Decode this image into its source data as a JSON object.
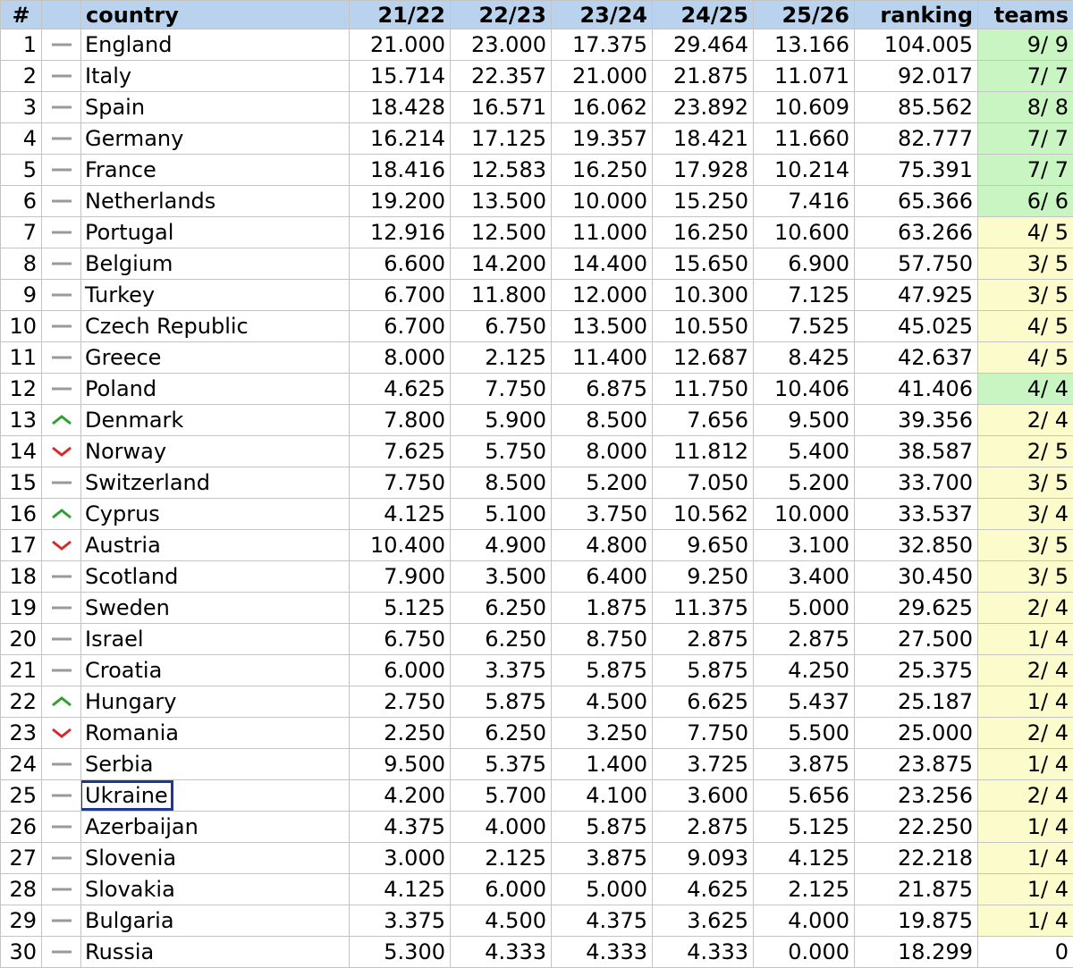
{
  "headers": {
    "rank": "#",
    "trend": "",
    "country": "country",
    "s1": "21/22",
    "s2": "22/23",
    "s3": "23/24",
    "s4": "24/25",
    "s5": "25/26",
    "ranking": "ranking",
    "teams": "teams"
  },
  "colors": {
    "header_bg": "#b9d3ee",
    "teams_complete": "#c8f5c1",
    "teams_partial": "#fbfbcb",
    "trend_up": "#2ea02e",
    "trend_down": "#d52b2b",
    "trend_same": "#9a9a9a",
    "selection_border": "#1d3a8f"
  },
  "selected_country": "Ukraine",
  "rows": [
    {
      "rank": "1",
      "trend": "same",
      "country": "England",
      "s1": "21.000",
      "s2": "23.000",
      "s3": "17.375",
      "s4": "29.464",
      "s5": "13.166",
      "ranking": "104.005",
      "teams": "9/ 9",
      "teams_status": "complete"
    },
    {
      "rank": "2",
      "trend": "same",
      "country": "Italy",
      "s1": "15.714",
      "s2": "22.357",
      "s3": "21.000",
      "s4": "21.875",
      "s5": "11.071",
      "ranking": "92.017",
      "teams": "7/ 7",
      "teams_status": "complete"
    },
    {
      "rank": "3",
      "trend": "same",
      "country": "Spain",
      "s1": "18.428",
      "s2": "16.571",
      "s3": "16.062",
      "s4": "23.892",
      "s5": "10.609",
      "ranking": "85.562",
      "teams": "8/ 8",
      "teams_status": "complete"
    },
    {
      "rank": "4",
      "trend": "same",
      "country": "Germany",
      "s1": "16.214",
      "s2": "17.125",
      "s3": "19.357",
      "s4": "18.421",
      "s5": "11.660",
      "ranking": "82.777",
      "teams": "7/ 7",
      "teams_status": "complete"
    },
    {
      "rank": "5",
      "trend": "same",
      "country": "France",
      "s1": "18.416",
      "s2": "12.583",
      "s3": "16.250",
      "s4": "17.928",
      "s5": "10.214",
      "ranking": "75.391",
      "teams": "7/ 7",
      "teams_status": "complete"
    },
    {
      "rank": "6",
      "trend": "same",
      "country": "Netherlands",
      "s1": "19.200",
      "s2": "13.500",
      "s3": "10.000",
      "s4": "15.250",
      "s5": "7.416",
      "ranking": "65.366",
      "teams": "6/ 6",
      "teams_status": "complete"
    },
    {
      "rank": "7",
      "trend": "same",
      "country": "Portugal",
      "s1": "12.916",
      "s2": "12.500",
      "s3": "11.000",
      "s4": "16.250",
      "s5": "10.600",
      "ranking": "63.266",
      "teams": "4/ 5",
      "teams_status": "partial"
    },
    {
      "rank": "8",
      "trend": "same",
      "country": "Belgium",
      "s1": "6.600",
      "s2": "14.200",
      "s3": "14.400",
      "s4": "15.650",
      "s5": "6.900",
      "ranking": "57.750",
      "teams": "3/ 5",
      "teams_status": "partial"
    },
    {
      "rank": "9",
      "trend": "same",
      "country": "Turkey",
      "s1": "6.700",
      "s2": "11.800",
      "s3": "12.000",
      "s4": "10.300",
      "s5": "7.125",
      "ranking": "47.925",
      "teams": "3/ 5",
      "teams_status": "partial"
    },
    {
      "rank": "10",
      "trend": "same",
      "country": "Czech Republic",
      "s1": "6.700",
      "s2": "6.750",
      "s3": "13.500",
      "s4": "10.550",
      "s5": "7.525",
      "ranking": "45.025",
      "teams": "4/ 5",
      "teams_status": "partial"
    },
    {
      "rank": "11",
      "trend": "same",
      "country": "Greece",
      "s1": "8.000",
      "s2": "2.125",
      "s3": "11.400",
      "s4": "12.687",
      "s5": "8.425",
      "ranking": "42.637",
      "teams": "4/ 5",
      "teams_status": "partial"
    },
    {
      "rank": "12",
      "trend": "same",
      "country": "Poland",
      "s1": "4.625",
      "s2": "7.750",
      "s3": "6.875",
      "s4": "11.750",
      "s5": "10.406",
      "ranking": "41.406",
      "teams": "4/ 4",
      "teams_status": "complete"
    },
    {
      "rank": "13",
      "trend": "up",
      "country": "Denmark",
      "s1": "7.800",
      "s2": "5.900",
      "s3": "8.500",
      "s4": "7.656",
      "s5": "9.500",
      "ranking": "39.356",
      "teams": "2/ 4",
      "teams_status": "partial"
    },
    {
      "rank": "14",
      "trend": "down",
      "country": "Norway",
      "s1": "7.625",
      "s2": "5.750",
      "s3": "8.000",
      "s4": "11.812",
      "s5": "5.400",
      "ranking": "38.587",
      "teams": "2/ 5",
      "teams_status": "partial"
    },
    {
      "rank": "15",
      "trend": "same",
      "country": "Switzerland",
      "s1": "7.750",
      "s2": "8.500",
      "s3": "5.200",
      "s4": "7.050",
      "s5": "5.200",
      "ranking": "33.700",
      "teams": "3/ 5",
      "teams_status": "partial"
    },
    {
      "rank": "16",
      "trend": "up",
      "country": "Cyprus",
      "s1": "4.125",
      "s2": "5.100",
      "s3": "3.750",
      "s4": "10.562",
      "s5": "10.000",
      "ranking": "33.537",
      "teams": "3/ 4",
      "teams_status": "partial"
    },
    {
      "rank": "17",
      "trend": "down",
      "country": "Austria",
      "s1": "10.400",
      "s2": "4.900",
      "s3": "4.800",
      "s4": "9.650",
      "s5": "3.100",
      "ranking": "32.850",
      "teams": "3/ 5",
      "teams_status": "partial"
    },
    {
      "rank": "18",
      "trend": "same",
      "country": "Scotland",
      "s1": "7.900",
      "s2": "3.500",
      "s3": "6.400",
      "s4": "9.250",
      "s5": "3.400",
      "ranking": "30.450",
      "teams": "3/ 5",
      "teams_status": "partial"
    },
    {
      "rank": "19",
      "trend": "same",
      "country": "Sweden",
      "s1": "5.125",
      "s2": "6.250",
      "s3": "1.875",
      "s4": "11.375",
      "s5": "5.000",
      "ranking": "29.625",
      "teams": "2/ 4",
      "teams_status": "partial"
    },
    {
      "rank": "20",
      "trend": "same",
      "country": "Israel",
      "s1": "6.750",
      "s2": "6.250",
      "s3": "8.750",
      "s4": "2.875",
      "s5": "2.875",
      "ranking": "27.500",
      "teams": "1/ 4",
      "teams_status": "partial"
    },
    {
      "rank": "21",
      "trend": "same",
      "country": "Croatia",
      "s1": "6.000",
      "s2": "3.375",
      "s3": "5.875",
      "s4": "5.875",
      "s5": "4.250",
      "ranking": "25.375",
      "teams": "2/ 4",
      "teams_status": "partial"
    },
    {
      "rank": "22",
      "trend": "up",
      "country": "Hungary",
      "s1": "2.750",
      "s2": "5.875",
      "s3": "4.500",
      "s4": "6.625",
      "s5": "5.437",
      "ranking": "25.187",
      "teams": "1/ 4",
      "teams_status": "partial"
    },
    {
      "rank": "23",
      "trend": "down",
      "country": "Romania",
      "s1": "2.250",
      "s2": "6.250",
      "s3": "3.250",
      "s4": "7.750",
      "s5": "5.500",
      "ranking": "25.000",
      "teams": "2/ 4",
      "teams_status": "partial"
    },
    {
      "rank": "24",
      "trend": "same",
      "country": "Serbia",
      "s1": "9.500",
      "s2": "5.375",
      "s3": "1.400",
      "s4": "3.725",
      "s5": "3.875",
      "ranking": "23.875",
      "teams": "1/ 4",
      "teams_status": "partial"
    },
    {
      "rank": "25",
      "trend": "same",
      "country": "Ukraine",
      "s1": "4.200",
      "s2": "5.700",
      "s3": "4.100",
      "s4": "3.600",
      "s5": "5.656",
      "ranking": "23.256",
      "teams": "2/ 4",
      "teams_status": "partial"
    },
    {
      "rank": "26",
      "trend": "same",
      "country": "Azerbaijan",
      "s1": "4.375",
      "s2": "4.000",
      "s3": "5.875",
      "s4": "2.875",
      "s5": "5.125",
      "ranking": "22.250",
      "teams": "1/ 4",
      "teams_status": "partial"
    },
    {
      "rank": "27",
      "trend": "same",
      "country": "Slovenia",
      "s1": "3.000",
      "s2": "2.125",
      "s3": "3.875",
      "s4": "9.093",
      "s5": "4.125",
      "ranking": "22.218",
      "teams": "1/ 4",
      "teams_status": "partial"
    },
    {
      "rank": "28",
      "trend": "same",
      "country": "Slovakia",
      "s1": "4.125",
      "s2": "6.000",
      "s3": "5.000",
      "s4": "4.625",
      "s5": "2.125",
      "ranking": "21.875",
      "teams": "1/ 4",
      "teams_status": "partial"
    },
    {
      "rank": "29",
      "trend": "same",
      "country": "Bulgaria",
      "s1": "3.375",
      "s2": "4.500",
      "s3": "4.375",
      "s4": "3.625",
      "s5": "4.000",
      "ranking": "19.875",
      "teams": "1/ 4",
      "teams_status": "partial"
    },
    {
      "rank": "30",
      "trend": "same",
      "country": "Russia",
      "s1": "5.300",
      "s2": "4.333",
      "s3": "4.333",
      "s4": "4.333",
      "s5": "0.000",
      "ranking": "18.299",
      "teams": "0",
      "teams_status": "none"
    }
  ]
}
